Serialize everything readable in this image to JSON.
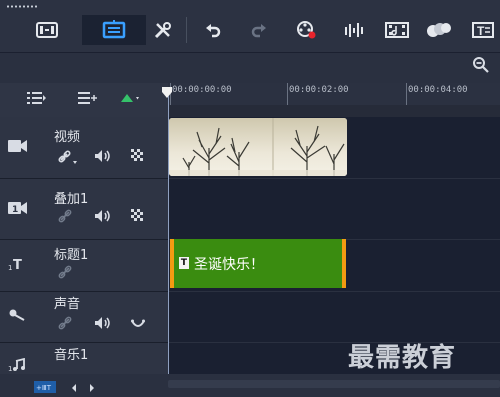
{
  "toolbar": {
    "items": [
      "library-icon",
      "timeline-view-icon",
      "tools-icon",
      "undo-icon",
      "redo-icon",
      "record-capture-icon",
      "sound-mixer-icon",
      "auto-music-icon",
      "mask-creator-icon",
      "title-icon"
    ]
  },
  "ruler": {
    "timecodes": [
      "00:00:00:00",
      "00:00:02:00",
      "00:00:04:00"
    ]
  },
  "tracks": [
    {
      "name": "视频"
    },
    {
      "name": "叠加1"
    },
    {
      "name": "标题1"
    },
    {
      "name": "声音"
    },
    {
      "name": "音乐1"
    }
  ],
  "title_clip": {
    "text": "圣诞快乐！"
  },
  "watermark": "最需教育",
  "colors": {
    "title_clip": "#3a8c10",
    "clip_border": "#f39b12",
    "add_track": "#35c26a"
  }
}
